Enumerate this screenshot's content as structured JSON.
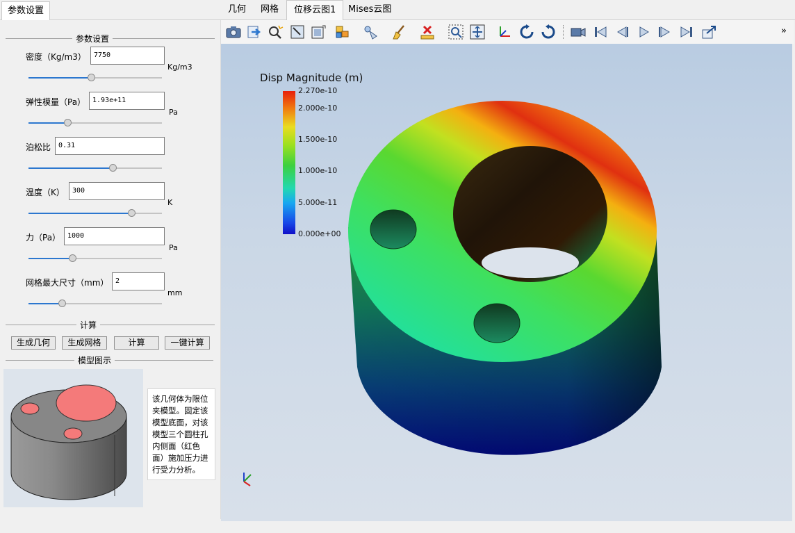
{
  "left_tab": "参数设置",
  "params_group_title": "参数设置",
  "params": [
    {
      "label": "密度（Kg/m3）",
      "value": "7750",
      "unit": "Kg/m3",
      "slider": 0.47
    },
    {
      "label": "弹性模量（Pa）",
      "value": "1.93e+11",
      "unit": "Pa",
      "slider": 0.29
    },
    {
      "label": "泊松比",
      "value": "0.31",
      "unit": "",
      "slider": 0.63
    },
    {
      "label": "温度（K）",
      "value": "300",
      "unit": "K",
      "slider": 0.77
    },
    {
      "label": "力（Pa）",
      "value": "1000",
      "unit": "Pa",
      "slider": 0.33
    },
    {
      "label": "网格最大尺寸（mm）",
      "value": "2",
      "unit": "mm",
      "slider": 0.25
    }
  ],
  "calc_group_title": "计算",
  "buttons": {
    "gen_geometry": "生成几何",
    "gen_mesh": "生成网格",
    "compute": "计算",
    "one_click": "一键计算"
  },
  "model_group_title": "模型图示",
  "description": "该几何体为限位\n夹模型。固定该\n模型底面，对该\n模型三个圆柱孔\n内侧面（红色\n面）施加压力进\n行受力分析。",
  "right_tabs": [
    {
      "label": "几何",
      "active": false
    },
    {
      "label": "网格",
      "active": false
    },
    {
      "label": "位移云图1",
      "active": true
    },
    {
      "label": "Mises云图",
      "active": false
    }
  ],
  "toolbar_icons": [
    "screenshot-icon",
    "export-icon",
    "zoom-interactive-icon",
    "select-icon",
    "frame-icon",
    "color-select-icon",
    "light-icon",
    "clean-icon",
    "delete-icon",
    "zoom-box-icon",
    "fit-view-icon",
    "axes-icon",
    "rotate-icon",
    "reset-rotate-icon",
    "camera-icon",
    "first-frame-icon",
    "prev-frame-icon",
    "play-icon",
    "next-frame-icon",
    "last-frame-icon",
    "save-icon"
  ],
  "overflow_label": "»",
  "legend": {
    "title": "Disp Magnitude (m)",
    "ticks": [
      "2.270e-10",
      "2.000e-10",
      "1.500e-10",
      "1.000e-10",
      "5.000e-11",
      "0.000e+00"
    ]
  },
  "colors": {
    "accent": "#2c77cf",
    "hot": "#e03010",
    "mid": "#4fd040",
    "cold": "#001aa8"
  }
}
